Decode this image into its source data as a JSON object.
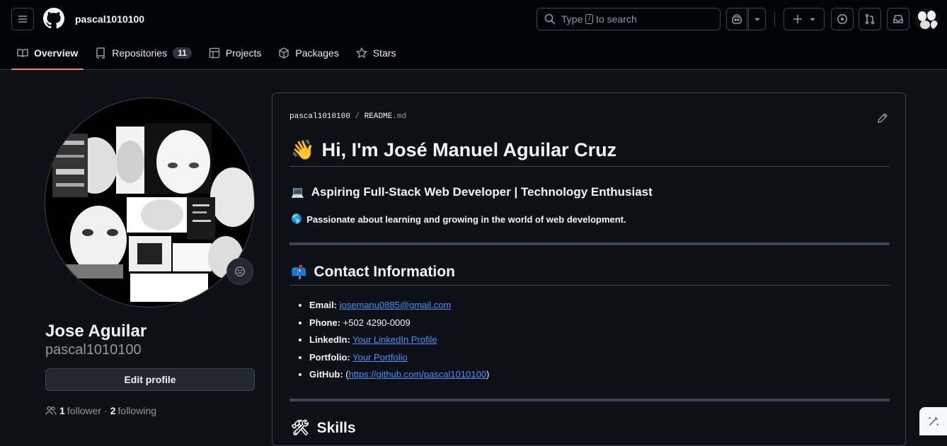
{
  "header": {
    "menu_icon": "hamburger-icon",
    "logo_icon": "github-logo-icon",
    "username": "pascal1010100",
    "search": {
      "prefix": "Type",
      "key": "/",
      "suffix": "to search"
    },
    "copilot_icon": "copilot-icon",
    "create_icon": "plus-icon",
    "issues_icon": "issue-opened-icon",
    "pulls_icon": "git-pull-request-icon",
    "inbox_icon": "inbox-icon"
  },
  "tabs": [
    {
      "label": "Overview",
      "icon": "book-icon",
      "active": true
    },
    {
      "label": "Repositories",
      "icon": "repo-icon",
      "count": "11"
    },
    {
      "label": "Projects",
      "icon": "table-icon"
    },
    {
      "label": "Packages",
      "icon": "package-icon"
    },
    {
      "label": "Stars",
      "icon": "star-icon"
    }
  ],
  "profile": {
    "full_name": "Jose Aguilar",
    "login": "pascal1010100",
    "edit_label": "Edit profile",
    "followers_count": "1",
    "followers_label": "follower",
    "separator": "·",
    "following_count": "2",
    "following_label": "following"
  },
  "readme": {
    "path_user": "pascal1010100",
    "path_sep": "/",
    "path_file": "README",
    "path_ext": ".md",
    "title_emoji": "👋",
    "title": "Hi, I'm José Manuel Aguilar Cruz",
    "subtitle_emoji": "💻",
    "subtitle": "Aspiring Full-Stack Web Developer | Technology Enthusiast",
    "tagline_emoji": "🌎",
    "tagline": "Passionate about learning and growing in the world of web development.",
    "contact_emoji": "📫",
    "contact_heading": "Contact Information",
    "contacts": [
      {
        "label": "Email:",
        "link": "josemanu0885@gmail.com"
      },
      {
        "label": "Phone:",
        "text": "+502 4290-0009"
      },
      {
        "label": "LinkedIn:",
        "link": "Your LinkedIn Profile"
      },
      {
        "label": "Portfolio:",
        "link": "Your Portfolio"
      },
      {
        "label": "GitHub:",
        "pre": "(",
        "link": "https://github.com/pascal1010100",
        "post": ")"
      }
    ],
    "skills_emoji": "🛠",
    "skills_heading": "Skills"
  },
  "colors": {
    "background": "#0d1117",
    "header": "#010409",
    "accent": "#f78166",
    "link": "#4493f8",
    "border": "#3d444d"
  }
}
